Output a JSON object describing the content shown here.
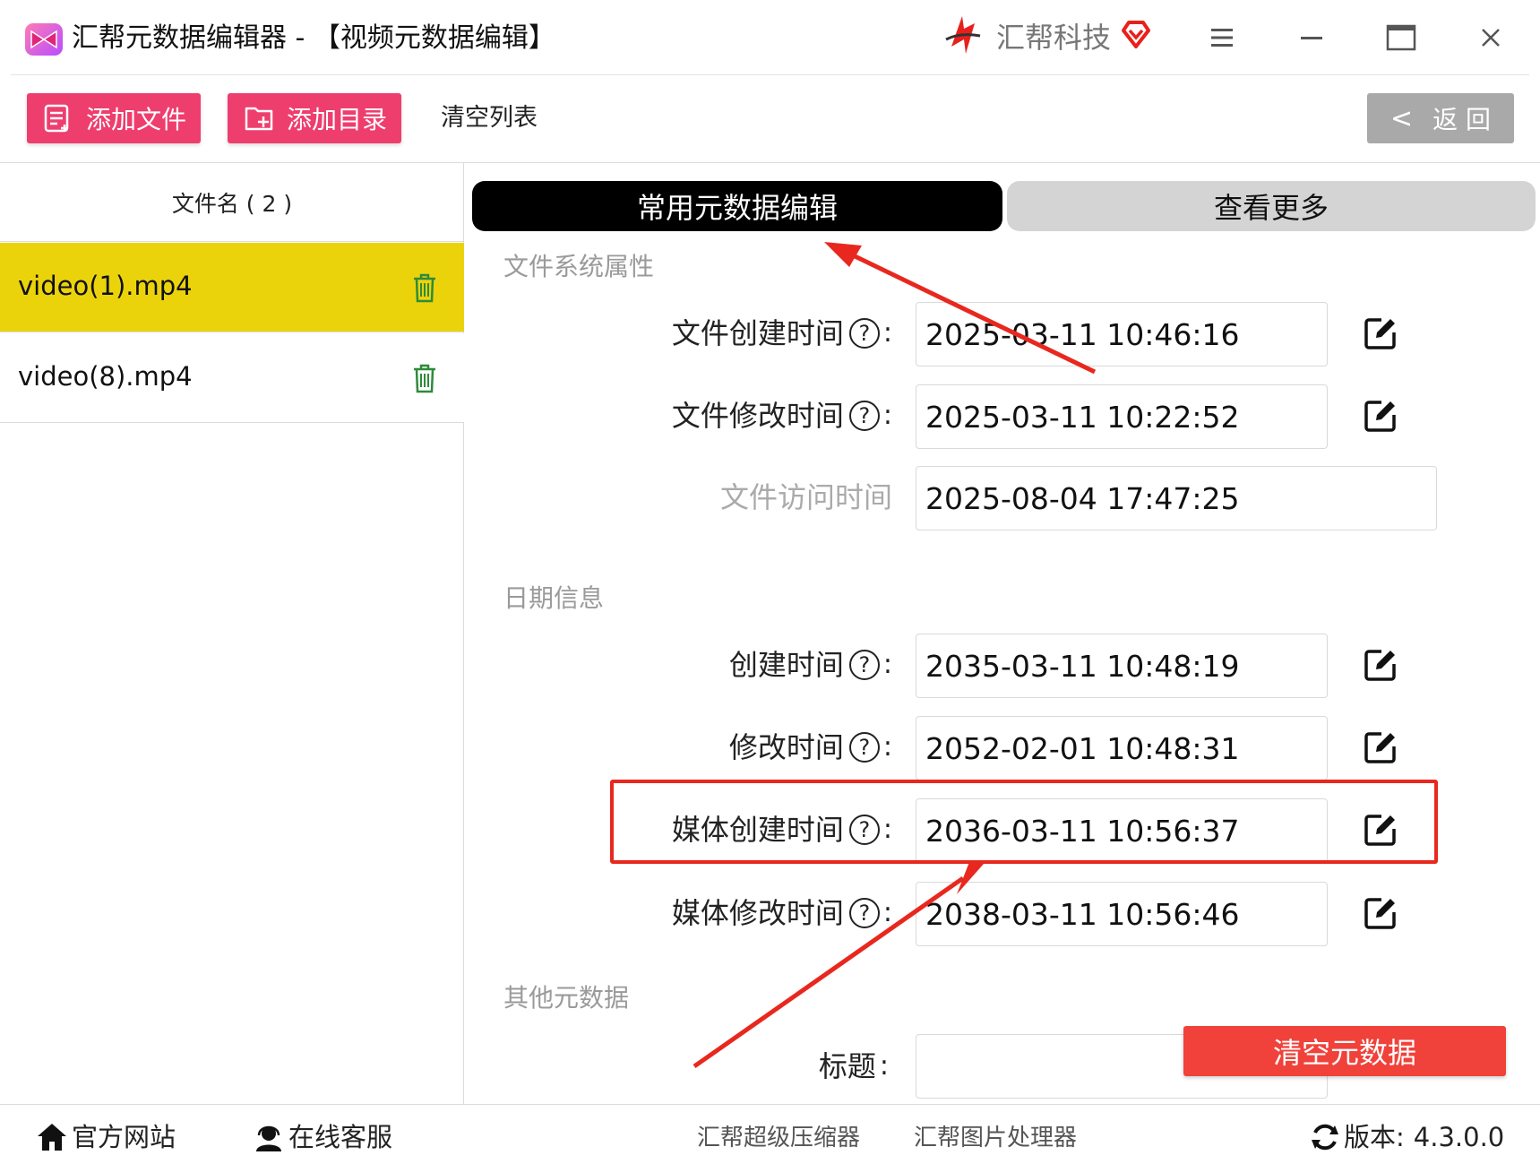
{
  "window": {
    "title": "汇帮元数据编辑器 - 【视频元数据编辑】",
    "brand": "汇帮科技"
  },
  "toolbar": {
    "add_file": "添加文件",
    "add_dir": "添加目录",
    "clear_list": "清空列表",
    "back": "返 回"
  },
  "file_list": {
    "header": "文件名 ( 2 )",
    "items": [
      {
        "name": "video(1).mp4",
        "selected": true
      },
      {
        "name": "video(8).mp4",
        "selected": false
      }
    ]
  },
  "tabs": {
    "common": "常用元数据编辑",
    "more": "查看更多"
  },
  "sections": {
    "fs": "文件系统属性",
    "date": "日期信息",
    "other": "其他元数据"
  },
  "fields": {
    "file_created": {
      "label": "文件创建时间",
      "value": "2025-03-11 10:46:16"
    },
    "file_modified": {
      "label": "文件修改时间",
      "value": "2025-03-11 10:22:52"
    },
    "file_accessed": {
      "label": "文件访问时间",
      "value": "2025-08-04 17:47:25"
    },
    "created": {
      "label": "创建时间",
      "value": "2035-03-11 10:48:19"
    },
    "modified": {
      "label": "修改时间",
      "value": "2052-02-01 10:48:31"
    },
    "media_created": {
      "label": "媒体创建时间",
      "value": "2036-03-11 10:56:37"
    },
    "media_modified": {
      "label": "媒体修改时间",
      "value": "2038-03-11 10:56:46"
    },
    "title": {
      "label": "标题",
      "value": ""
    }
  },
  "help_glyph": "?",
  "colon": ":",
  "actions": {
    "clear_metadata": "清空元数据"
  },
  "footer": {
    "site": "官方网站",
    "service": "在线客服",
    "link1": "汇帮超级压缩器",
    "link2": "汇帮图片处理器",
    "version_label": "版本:",
    "version": "4.3.0.0"
  },
  "colors": {
    "accent_pink": "#ee3e6e",
    "selected_row": "#ebd30c",
    "annotation_red": "#e8281e",
    "clear_button": "#f0423a"
  },
  "icons": [
    "app-logo-icon",
    "brand-icon",
    "vip-heart-icon",
    "menu-icon",
    "minimize-icon",
    "maximize-icon",
    "close-icon",
    "add-file-icon",
    "add-folder-icon",
    "chevron-left-icon",
    "trash-icon",
    "help-icon",
    "edit-icon",
    "home-icon",
    "headset-icon",
    "refresh-icon"
  ]
}
